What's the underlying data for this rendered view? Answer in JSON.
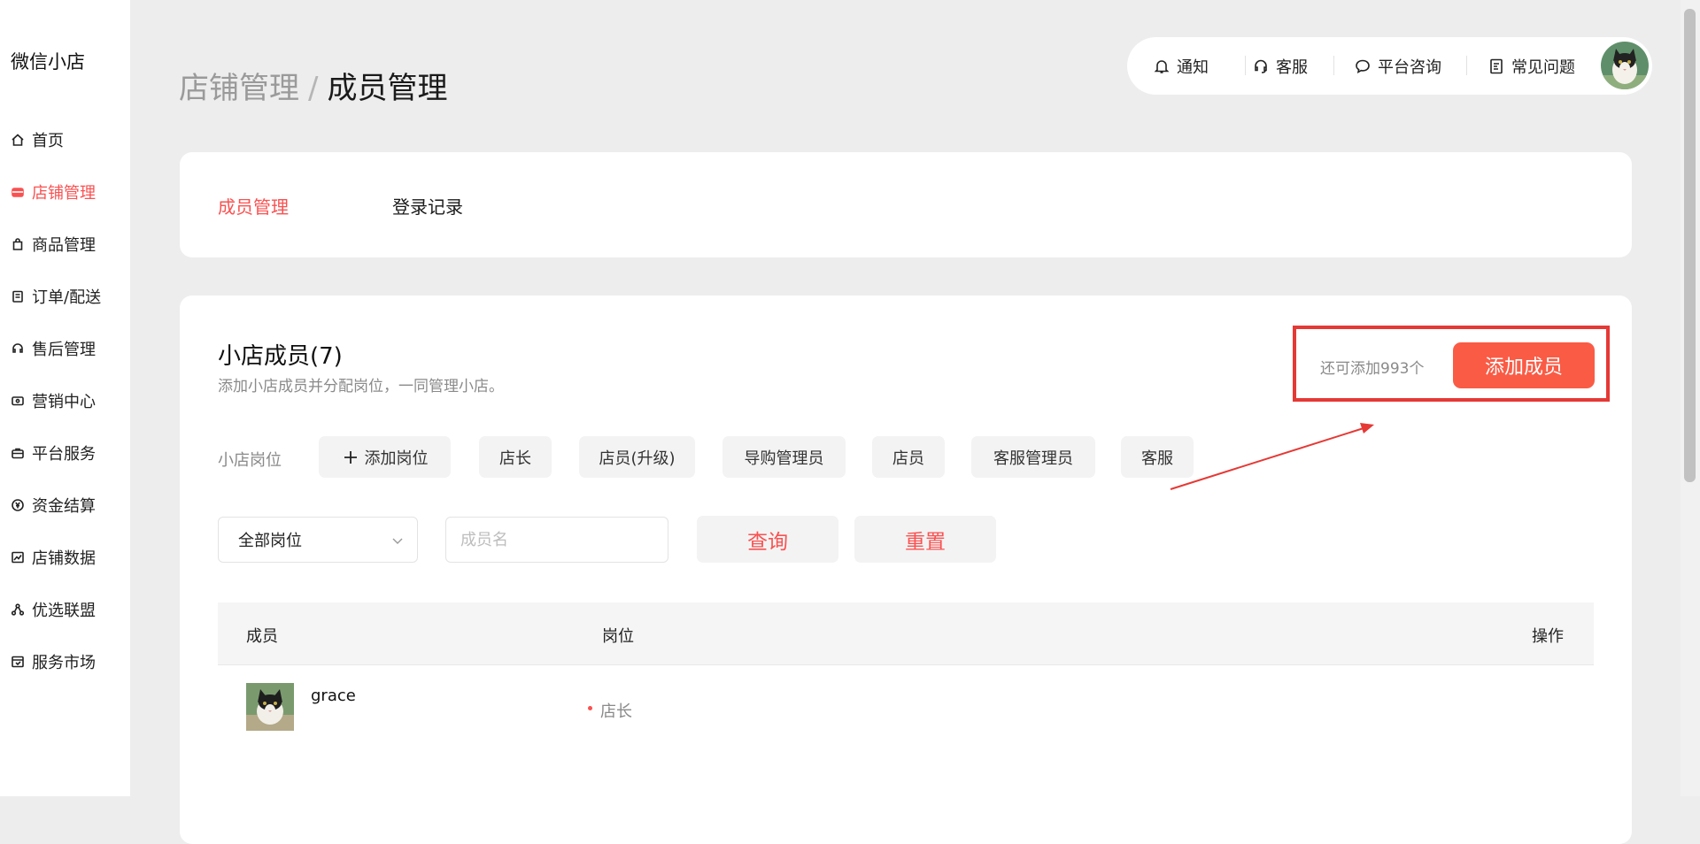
{
  "sidebar": {
    "brand": "微信小店",
    "items": [
      {
        "label": "首页",
        "icon": "home-icon"
      },
      {
        "label": "店铺管理",
        "icon": "store-icon",
        "active": true
      },
      {
        "label": "商品管理",
        "icon": "bag-icon"
      },
      {
        "label": "订单/配送",
        "icon": "order-icon"
      },
      {
        "label": "售后管理",
        "icon": "headset-icon"
      },
      {
        "label": "营销中心",
        "icon": "ticket-icon"
      },
      {
        "label": "平台服务",
        "icon": "briefcase-icon"
      },
      {
        "label": "资金结算",
        "icon": "yen-icon"
      },
      {
        "label": "店铺数据",
        "icon": "chart-icon"
      },
      {
        "label": "优选联盟",
        "icon": "network-icon"
      },
      {
        "label": "服务市场",
        "icon": "market-icon"
      }
    ]
  },
  "breadcrumb": {
    "parent": "店铺管理",
    "separator": "/",
    "current": "成员管理"
  },
  "header": {
    "notify": "通知",
    "service": "客服",
    "consult": "平台咨询",
    "faq": "常见问题"
  },
  "tabs": [
    {
      "label": "成员管理",
      "active": true
    },
    {
      "label": "登录记录",
      "active": false
    }
  ],
  "members": {
    "title": "小店成员(7)",
    "description": "添加小店成员并分配岗位，一同管理小店。",
    "remaining": "还可添加993个",
    "add_button": "添加成员"
  },
  "roles": {
    "label": "小店岗位",
    "add_role": "添加岗位",
    "chips": [
      "店长",
      "店员(升级)",
      "导购管理员",
      "店员",
      "客服管理员",
      "客服"
    ]
  },
  "filters": {
    "select_value": "全部岗位",
    "name_placeholder": "成员名",
    "query_button": "查询",
    "reset_button": "重置"
  },
  "table": {
    "headers": {
      "member": "成员",
      "role": "岗位",
      "action": "操作"
    },
    "rows": [
      {
        "name": "grace",
        "role": "店长"
      }
    ]
  },
  "colors": {
    "accent": "#fa5151",
    "highlight": "#e53935",
    "button": "#fa5b45"
  }
}
